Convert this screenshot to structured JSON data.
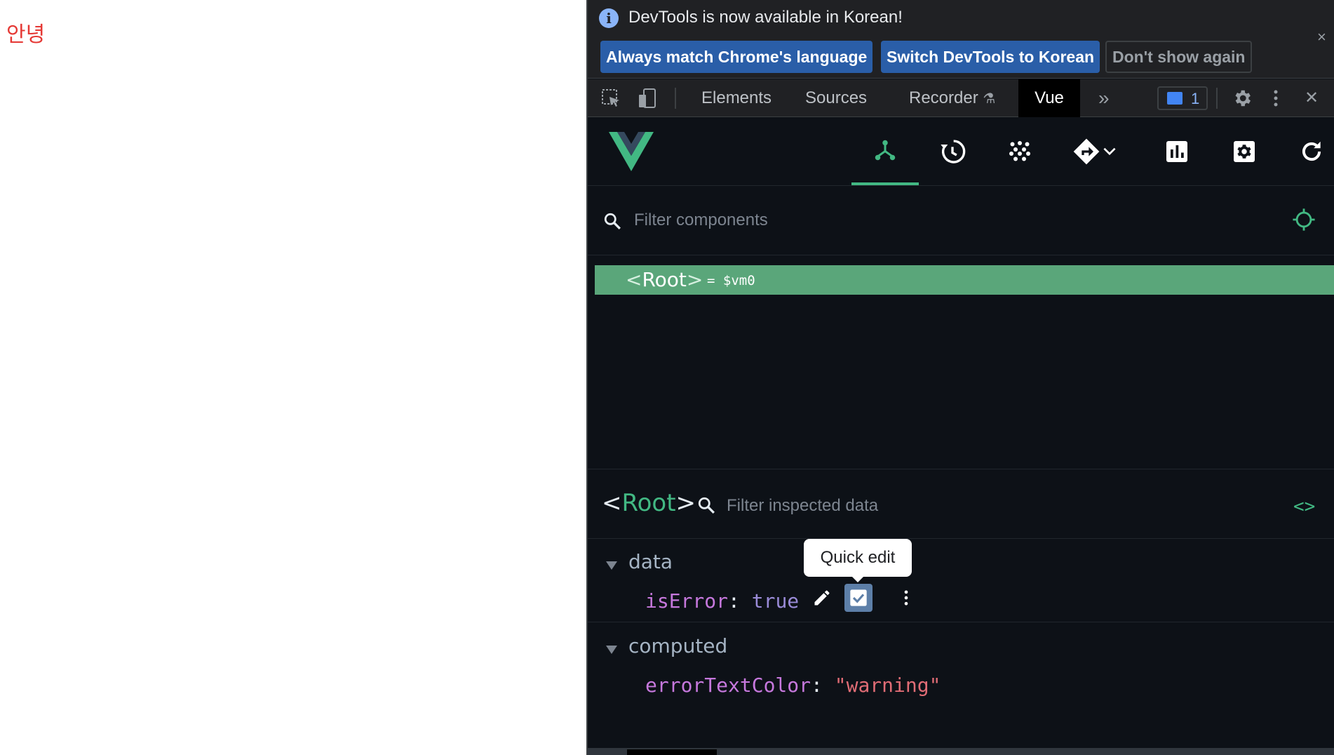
{
  "page": {
    "greeting": "안녕",
    "greeting_color": "#e53935"
  },
  "infobar": {
    "message": "DevTools is now available in Korean!",
    "buttons": {
      "always_match": "Always match Chrome's language",
      "switch": "Switch DevTools to Korean",
      "dont_show": "Don't show again"
    },
    "close_label": "×"
  },
  "tabbar": {
    "tabs": [
      "Elements",
      "Sources",
      "Recorder",
      "Vue"
    ],
    "active_tab": "Vue",
    "more": "»",
    "issues_count": "1",
    "close_label": "✕"
  },
  "vue": {
    "accent": "#42b883",
    "toolbar": [
      "components-icon",
      "timeline-icon",
      "pinia-icon",
      "router-icon",
      "performance-icon",
      "settings-icon",
      "refresh-icon"
    ],
    "active_tool": "components-icon",
    "filter_placeholder": "Filter components",
    "tree": {
      "root_open": "<",
      "root_name": "Root",
      "root_close": ">",
      "vm_ref": "= $vm0"
    },
    "inspector": {
      "open": "<",
      "name": "Root",
      "close": ">",
      "filter_placeholder": "Filter inspected data",
      "code_toggle": "<>",
      "sections": [
        {
          "title": "data",
          "props": [
            {
              "key": "isError",
              "value": "true"
            }
          ]
        },
        {
          "title": "computed",
          "props": [
            {
              "key": "errorTextColor",
              "value": "\"warning\""
            }
          ]
        }
      ],
      "colon": ":",
      "tooltip": "Quick edit"
    }
  }
}
